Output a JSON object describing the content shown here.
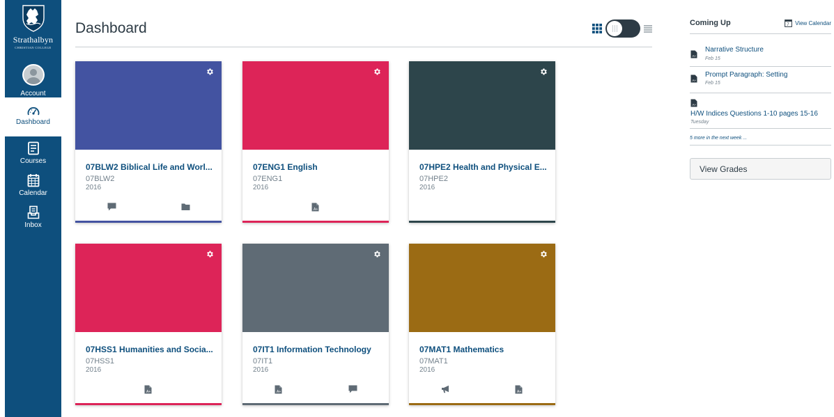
{
  "nav": {
    "logo": {
      "name": "Strathalbyn",
      "subtitle": "CHRISTIAN COLLEGE"
    },
    "items": [
      {
        "label": "Account",
        "icon": "user-avatar-icon"
      },
      {
        "label": "Dashboard",
        "icon": "dashboard-icon",
        "active": true
      },
      {
        "label": "Courses",
        "icon": "courses-icon"
      },
      {
        "label": "Calendar",
        "icon": "calendar-icon"
      },
      {
        "label": "Inbox",
        "icon": "inbox-icon"
      }
    ]
  },
  "header": {
    "title": "Dashboard"
  },
  "view_toggle": {
    "mode": "card-view",
    "icons": [
      "grid-view-icon",
      "list-view-icon"
    ]
  },
  "courses": [
    {
      "title": "07BLW2 Biblical Life and Worl...",
      "code": "07BLW2",
      "term": "2016",
      "color": "#4353a1",
      "actions": [
        "discussions-icon",
        "files-icon"
      ]
    },
    {
      "title": "07ENG1 English",
      "code": "07ENG1",
      "term": "2016",
      "color": "#dd2458",
      "actions": [
        "assignments-icon"
      ]
    },
    {
      "title": "07HPE2 Health and Physical E...",
      "code": "07HPE2",
      "term": "2016",
      "color": "#2d454b",
      "actions": []
    },
    {
      "title": "07HSS1 Humanities and Socia...",
      "code": "07HSS1",
      "term": "2016",
      "color": "#dd2458",
      "actions": [
        "assignments-icon"
      ]
    },
    {
      "title": "07IT1 Information Technology",
      "code": "07IT1",
      "term": "2016",
      "color": "#5f6b75",
      "actions": [
        "assignments-icon",
        "discussions-icon"
      ]
    },
    {
      "title": "07MAT1 Mathematics",
      "code": "07MAT1",
      "term": "2016",
      "color": "#9b6b14",
      "actions": [
        "announcements-icon",
        "assignments-icon"
      ]
    }
  ],
  "coming_up": {
    "title": "Coming Up",
    "calendar_day": "7",
    "view_calendar": "View Calendar",
    "items": [
      {
        "title": "Narrative Structure",
        "date": "Feb 15",
        "icon": "assignment-icon"
      },
      {
        "title": "Prompt Paragraph: Setting",
        "date": "Feb 15",
        "icon": "assignment-icon"
      },
      {
        "title": "H/W Indices Questions 1-10 pages 15-16",
        "date": "Tuesday",
        "icon": "assignment-icon"
      }
    ],
    "more": "5 more in the next week ..."
  },
  "view_grades": "View Grades",
  "colors": {
    "nav": "#0e4f7d",
    "link": "#0e4f7d",
    "text": "#2d3b45",
    "muted": "#73818c",
    "border": "#c7cdd1"
  }
}
